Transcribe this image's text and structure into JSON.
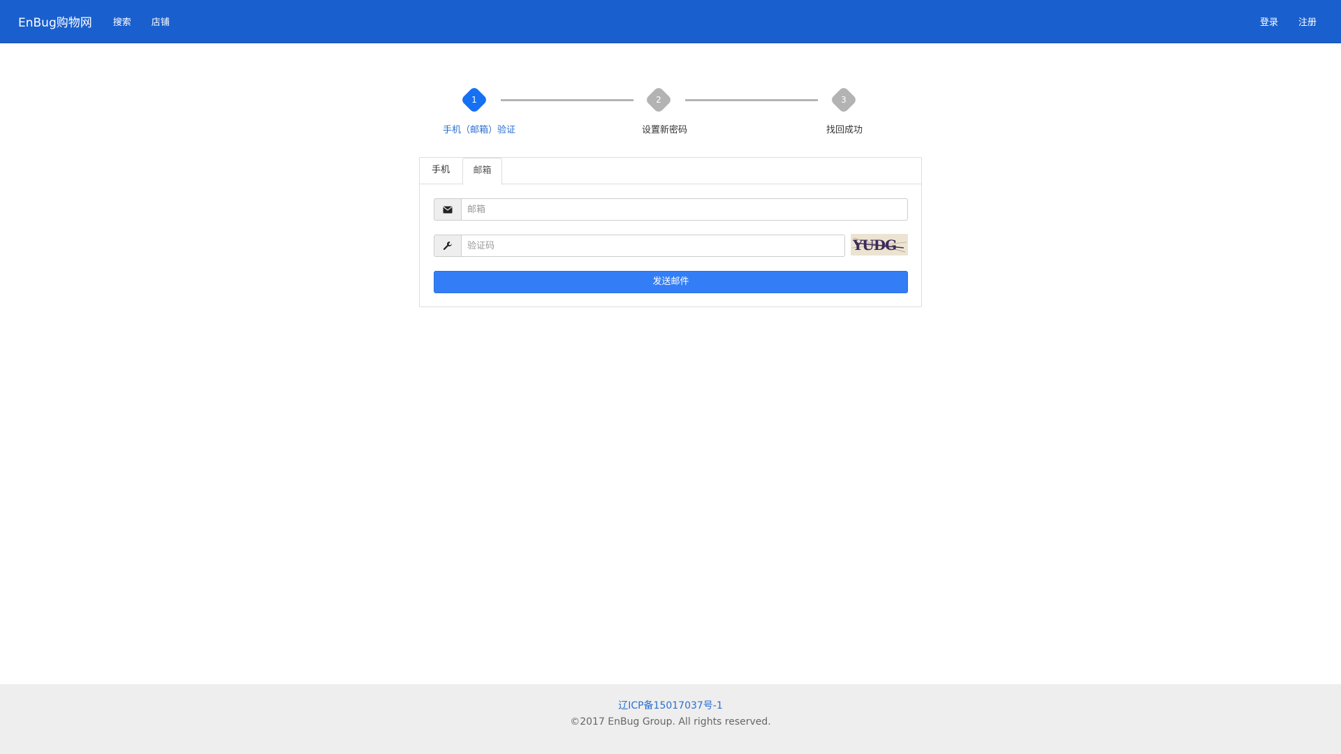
{
  "navbar": {
    "brand": "EnBug购物网",
    "links": [
      "搜索",
      "店铺"
    ],
    "login": "登录",
    "register": "注册"
  },
  "stepper": {
    "steps": [
      {
        "num": "1",
        "label": "手机（邮箱）验证",
        "state": "active"
      },
      {
        "num": "2",
        "label": "设置新密码",
        "state": "pending"
      },
      {
        "num": "3",
        "label": "找回成功",
        "state": "pending"
      }
    ],
    "colors": {
      "active": "#1670f2",
      "pending": "#b3b3b3",
      "active_label": "#2a6fd0"
    }
  },
  "tabs": {
    "phone": "手机",
    "email": "邮箱",
    "selected": "邮箱"
  },
  "form": {
    "email_placeholder": "邮箱",
    "code_placeholder": "验证码",
    "captcha_text": "YUDG",
    "submit": "发送邮件"
  },
  "footer": {
    "icp": "辽ICP备15017037号-1",
    "copyright": "©2017 EnBug Group. All rights reserved."
  },
  "colors": {
    "navbar": "#1a5fce",
    "button": "#337ef7",
    "footer": "#eeeeee"
  }
}
